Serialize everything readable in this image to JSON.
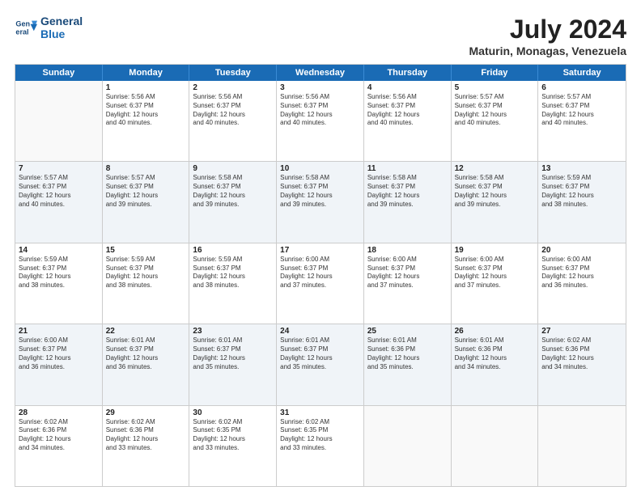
{
  "logo": {
    "line1": "General",
    "line2": "Blue"
  },
  "title": "July 2024",
  "subtitle": "Maturin, Monagas, Venezuela",
  "header": {
    "days": [
      "Sunday",
      "Monday",
      "Tuesday",
      "Wednesday",
      "Thursday",
      "Friday",
      "Saturday"
    ]
  },
  "weeks": [
    {
      "cells": [
        {
          "day": "",
          "info": ""
        },
        {
          "day": "1",
          "info": "Sunrise: 5:56 AM\nSunset: 6:37 PM\nDaylight: 12 hours\nand 40 minutes."
        },
        {
          "day": "2",
          "info": "Sunrise: 5:56 AM\nSunset: 6:37 PM\nDaylight: 12 hours\nand 40 minutes."
        },
        {
          "day": "3",
          "info": "Sunrise: 5:56 AM\nSunset: 6:37 PM\nDaylight: 12 hours\nand 40 minutes."
        },
        {
          "day": "4",
          "info": "Sunrise: 5:56 AM\nSunset: 6:37 PM\nDaylight: 12 hours\nand 40 minutes."
        },
        {
          "day": "5",
          "info": "Sunrise: 5:57 AM\nSunset: 6:37 PM\nDaylight: 12 hours\nand 40 minutes."
        },
        {
          "day": "6",
          "info": "Sunrise: 5:57 AM\nSunset: 6:37 PM\nDaylight: 12 hours\nand 40 minutes."
        }
      ]
    },
    {
      "cells": [
        {
          "day": "7",
          "info": "Sunrise: 5:57 AM\nSunset: 6:37 PM\nDaylight: 12 hours\nand 40 minutes."
        },
        {
          "day": "8",
          "info": "Sunrise: 5:57 AM\nSunset: 6:37 PM\nDaylight: 12 hours\nand 39 minutes."
        },
        {
          "day": "9",
          "info": "Sunrise: 5:58 AM\nSunset: 6:37 PM\nDaylight: 12 hours\nand 39 minutes."
        },
        {
          "day": "10",
          "info": "Sunrise: 5:58 AM\nSunset: 6:37 PM\nDaylight: 12 hours\nand 39 minutes."
        },
        {
          "day": "11",
          "info": "Sunrise: 5:58 AM\nSunset: 6:37 PM\nDaylight: 12 hours\nand 39 minutes."
        },
        {
          "day": "12",
          "info": "Sunrise: 5:58 AM\nSunset: 6:37 PM\nDaylight: 12 hours\nand 39 minutes."
        },
        {
          "day": "13",
          "info": "Sunrise: 5:59 AM\nSunset: 6:37 PM\nDaylight: 12 hours\nand 38 minutes."
        }
      ]
    },
    {
      "cells": [
        {
          "day": "14",
          "info": "Sunrise: 5:59 AM\nSunset: 6:37 PM\nDaylight: 12 hours\nand 38 minutes."
        },
        {
          "day": "15",
          "info": "Sunrise: 5:59 AM\nSunset: 6:37 PM\nDaylight: 12 hours\nand 38 minutes."
        },
        {
          "day": "16",
          "info": "Sunrise: 5:59 AM\nSunset: 6:37 PM\nDaylight: 12 hours\nand 38 minutes."
        },
        {
          "day": "17",
          "info": "Sunrise: 6:00 AM\nSunset: 6:37 PM\nDaylight: 12 hours\nand 37 minutes."
        },
        {
          "day": "18",
          "info": "Sunrise: 6:00 AM\nSunset: 6:37 PM\nDaylight: 12 hours\nand 37 minutes."
        },
        {
          "day": "19",
          "info": "Sunrise: 6:00 AM\nSunset: 6:37 PM\nDaylight: 12 hours\nand 37 minutes."
        },
        {
          "day": "20",
          "info": "Sunrise: 6:00 AM\nSunset: 6:37 PM\nDaylight: 12 hours\nand 36 minutes."
        }
      ]
    },
    {
      "cells": [
        {
          "day": "21",
          "info": "Sunrise: 6:00 AM\nSunset: 6:37 PM\nDaylight: 12 hours\nand 36 minutes."
        },
        {
          "day": "22",
          "info": "Sunrise: 6:01 AM\nSunset: 6:37 PM\nDaylight: 12 hours\nand 36 minutes."
        },
        {
          "day": "23",
          "info": "Sunrise: 6:01 AM\nSunset: 6:37 PM\nDaylight: 12 hours\nand 35 minutes."
        },
        {
          "day": "24",
          "info": "Sunrise: 6:01 AM\nSunset: 6:37 PM\nDaylight: 12 hours\nand 35 minutes."
        },
        {
          "day": "25",
          "info": "Sunrise: 6:01 AM\nSunset: 6:36 PM\nDaylight: 12 hours\nand 35 minutes."
        },
        {
          "day": "26",
          "info": "Sunrise: 6:01 AM\nSunset: 6:36 PM\nDaylight: 12 hours\nand 34 minutes."
        },
        {
          "day": "27",
          "info": "Sunrise: 6:02 AM\nSunset: 6:36 PM\nDaylight: 12 hours\nand 34 minutes."
        }
      ]
    },
    {
      "cells": [
        {
          "day": "28",
          "info": "Sunrise: 6:02 AM\nSunset: 6:36 PM\nDaylight: 12 hours\nand 34 minutes."
        },
        {
          "day": "29",
          "info": "Sunrise: 6:02 AM\nSunset: 6:36 PM\nDaylight: 12 hours\nand 33 minutes."
        },
        {
          "day": "30",
          "info": "Sunrise: 6:02 AM\nSunset: 6:35 PM\nDaylight: 12 hours\nand 33 minutes."
        },
        {
          "day": "31",
          "info": "Sunrise: 6:02 AM\nSunset: 6:35 PM\nDaylight: 12 hours\nand 33 minutes."
        },
        {
          "day": "",
          "info": ""
        },
        {
          "day": "",
          "info": ""
        },
        {
          "day": "",
          "info": ""
        }
      ]
    }
  ]
}
